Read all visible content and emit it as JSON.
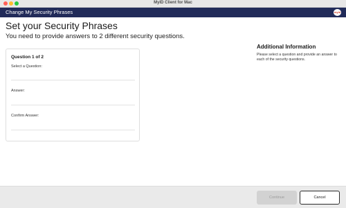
{
  "window": {
    "title": "MyID Client for Mac"
  },
  "appbar": {
    "title": "Change My Security Phrases",
    "logo_text": "myid",
    "brand_color": "#212b59"
  },
  "page": {
    "title": "Set your Security Phrases",
    "subtitle": "You need to provide answers to 2 different security questions."
  },
  "question_card": {
    "heading": "Question 1 of 2",
    "select_label": "Select a Question:",
    "select_value": "",
    "answer_label": "Answer:",
    "answer_value": "",
    "confirm_label": "Confirm Answer:",
    "confirm_value": ""
  },
  "info": {
    "heading": "Additional Information",
    "text": "Please select a question and provide an answer to each of the security questions."
  },
  "footer": {
    "continue_label": "Continue",
    "continue_enabled": false,
    "cancel_label": "Cancel"
  }
}
